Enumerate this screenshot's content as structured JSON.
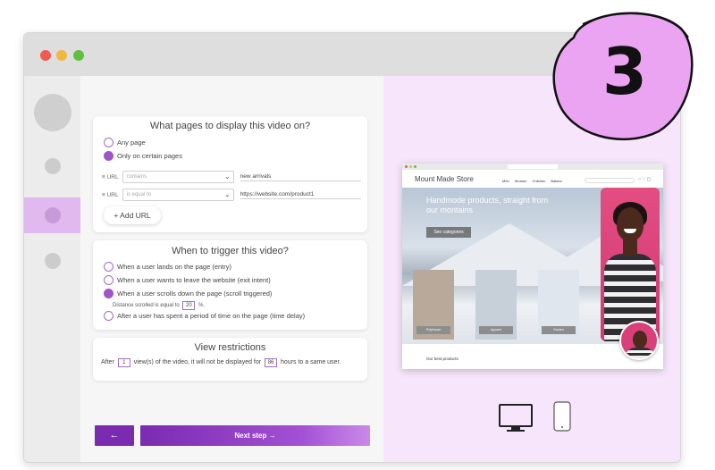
{
  "display_card": {
    "title": "What pages to display this video on?",
    "options": [
      "Any page",
      "Only on certain pages"
    ],
    "selected": 1,
    "url_rows": [
      {
        "label": "URL",
        "condition": "contains",
        "value": "new arrivals"
      },
      {
        "label": "URL",
        "condition": "is equal to",
        "value": "https://website.com/product1"
      }
    ],
    "add_url_label": "+ Add URL"
  },
  "trigger_card": {
    "title": "When to trigger this video?",
    "options": [
      "When a user lands on the page (entry)",
      "When a user wants to leave the website (exit intent)",
      "When a user scrolls down the page (scroll triggered)",
      "After a user has spent a period of time on the page (time delay)"
    ],
    "selected": 2,
    "scroll_note_prefix": "Distance scrolled is equal to",
    "scroll_value": "20",
    "scroll_unit": "%."
  },
  "restrictions_card": {
    "title": "View restrictions",
    "text_before": "After",
    "views_value": "1",
    "text_middle": "view(s) of the video, it will not be displayed for",
    "hours_value": "86",
    "text_after": "hours to a same user."
  },
  "footer": {
    "back_label": "←",
    "next_label": "Next step →"
  },
  "preview": {
    "store_name": "Mount Made Store",
    "nav_items": [
      "Men",
      "Women",
      "Children",
      "Babies"
    ],
    "hero_text": "Handmode products, straight from our montains",
    "see_categories": "See categories",
    "products": [
      "Polyhouse",
      "Apparel",
      "Garden"
    ],
    "best_products": "Our best products"
  },
  "step_badge": "3",
  "colors": {
    "accent": "#7a2bb0",
    "accent_light": "#e1b9ee",
    "preview_bg": "#f7e6fb",
    "badge_fill": "#eba4f2"
  }
}
